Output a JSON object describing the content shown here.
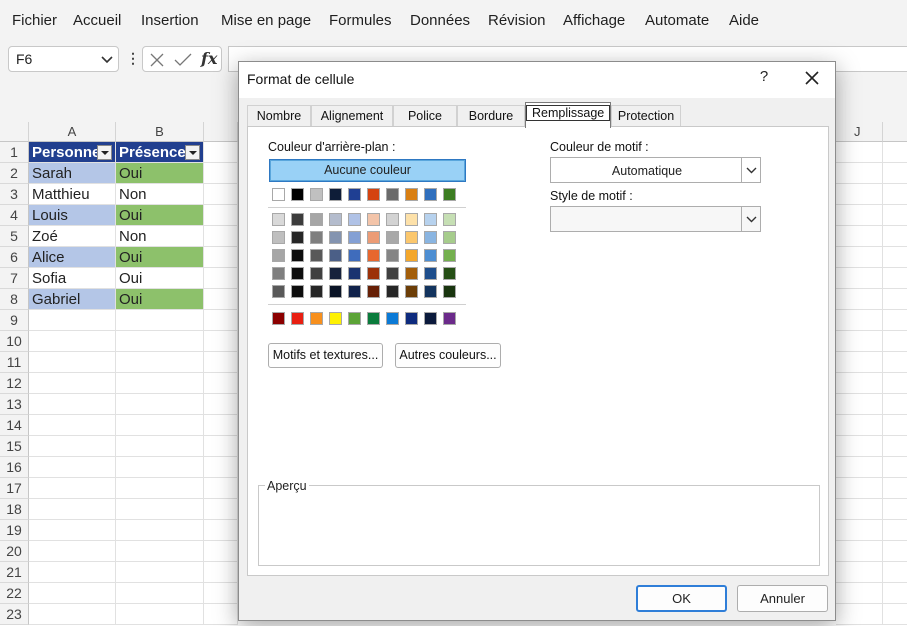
{
  "menu": [
    "Fichier",
    "Accueil",
    "Insertion",
    "Mise en page",
    "Formules",
    "Données",
    "Révision",
    "Affichage",
    "Automate",
    "Aide"
  ],
  "formula_bar": {
    "name_box": "F6",
    "fx": "fx"
  },
  "grid": {
    "columns": [
      "A",
      "B",
      "J"
    ],
    "rows": [
      "1",
      "2",
      "3",
      "4",
      "5",
      "6",
      "7",
      "8",
      "9",
      "10",
      "11",
      "12",
      "13",
      "14",
      "15",
      "16",
      "17",
      "18",
      "19",
      "20",
      "21",
      "22",
      "23"
    ],
    "header": [
      "Personne",
      "Présence"
    ],
    "data": [
      [
        "Sarah",
        "Oui"
      ],
      [
        "Matthieu",
        "Non"
      ],
      [
        "Louis",
        "Oui"
      ],
      [
        "Zoé",
        "Non"
      ],
      [
        "Alice",
        "Oui"
      ],
      [
        "Sofia",
        "Oui"
      ],
      [
        "Gabriel",
        "Oui"
      ]
    ]
  },
  "dialog": {
    "title": "Format de cellule",
    "help": "?",
    "tabs": [
      "Nombre",
      "Alignement",
      "Police",
      "Bordure",
      "Remplissage",
      "Protection"
    ],
    "active_tab": "Remplissage",
    "bg_color_label": "Couleur d'arrière-plan :",
    "no_color": "Aucune couleur",
    "pattern_color_label": "Couleur de motif :",
    "pattern_color_value": "Automatique",
    "pattern_style_label": "Style de motif :",
    "pattern_style_value": "",
    "fill_effects_button": "Motifs et textures...",
    "more_colors_button": "Autres couleurs...",
    "preview_label": "Aperçu",
    "ok": "OK",
    "cancel": "Annuler"
  },
  "colors": {
    "theme_row": [
      "#ffffff",
      "#000000",
      "#c0c0c0",
      "#0e1d38",
      "#1f3f93",
      "#d44310",
      "#6b6b6b",
      "#d97f12",
      "#2f6fbd",
      "#3c7d22"
    ],
    "tint_rows": [
      [
        "#d9d9d9",
        "#3c3c3c",
        "#a6a6a6",
        "#b4bccd",
        "#b0c2e6",
        "#f3c4a9",
        "#d3d3d3",
        "#fde1a9",
        "#b7d2ee",
        "#c6dfb4"
      ],
      [
        "#bfbfbf",
        "#262626",
        "#7f7f7f",
        "#8494b0",
        "#84a0d4",
        "#ec9c76",
        "#a9a9a9",
        "#fbc76d",
        "#8ab5e1",
        "#a6cc8c"
      ],
      [
        "#a6a6a6",
        "#0d0d0d",
        "#595959",
        "#4b5f87",
        "#3f6cbc",
        "#e7672e",
        "#858585",
        "#f4a72b",
        "#4d8ed2",
        "#74b04f"
      ],
      [
        "#7f7f7f",
        "#0d0d0d",
        "#404040",
        "#16223c",
        "#1a3370",
        "#9c3109",
        "#404040",
        "#a35e0a",
        "#1e4e8c",
        "#264f16"
      ],
      [
        "#595959",
        "#0d0d0d",
        "#262626",
        "#0a1426",
        "#11224b",
        "#672006",
        "#262626",
        "#6c3e07",
        "#13345e",
        "#19350f"
      ]
    ],
    "standard_row": [
      "#8b0000",
      "#e81f12",
      "#f7901e",
      "#fef102",
      "#5ca437",
      "#0a7b3c",
      "#0b7ad6",
      "#0e2b7e",
      "#0b1a3c",
      "#6b2a8a"
    ]
  }
}
